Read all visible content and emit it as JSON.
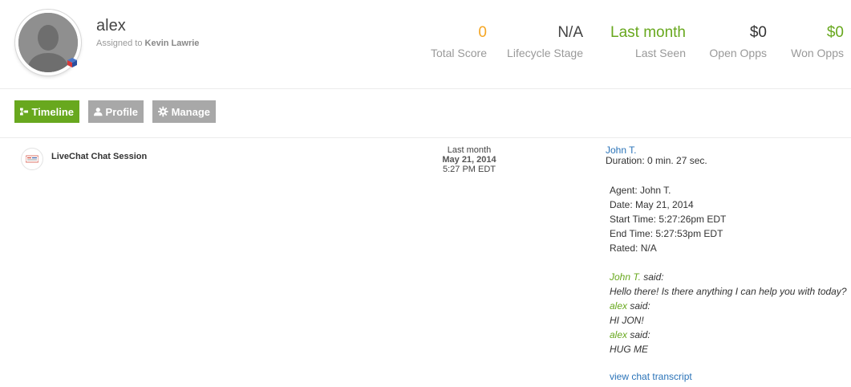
{
  "contact": {
    "name": "alex",
    "assigned_prefix": "Assigned to",
    "assigned_to": "Kevin Lawrie"
  },
  "stats": [
    {
      "value": "0",
      "label": "Total Score",
      "color": "#f5a623"
    },
    {
      "value": "N/A",
      "label": "Lifecycle Stage",
      "color": "#444444"
    },
    {
      "value": "Last month",
      "label": "Last Seen",
      "color": "#68a81e"
    },
    {
      "value": "$0",
      "label": "Open Opps",
      "color": "#333333"
    },
    {
      "value": "$0",
      "label": "Won Opps",
      "color": "#68a81e"
    }
  ],
  "tabs": [
    {
      "label": "Timeline",
      "icon": "timeline-icon",
      "active": true
    },
    {
      "label": "Profile",
      "icon": "person-icon",
      "active": false
    },
    {
      "label": "Manage",
      "icon": "gear-icon",
      "active": false
    }
  ],
  "entry": {
    "icon": "livechat-logo-icon",
    "title": "LiveChat Chat Session",
    "when_relative": "Last month",
    "when_date": "May 21, 2014",
    "when_time": "5:27 PM EDT",
    "agent_link": "John T.",
    "duration": "Duration: 0 min. 27 sec.",
    "meta": [
      "Agent: John T.",
      "Date: May 21, 2014",
      "Start Time: 5:27:26pm EDT",
      "End Time: 5:27:53pm EDT",
      "Rated: N/A"
    ],
    "transcript": [
      {
        "who": "John T.",
        "said": " said:",
        "text": "Hello there! Is there anything I can help you with today?"
      },
      {
        "who": "alex",
        "said": " said:",
        "text": "HI JON!"
      },
      {
        "who": "alex",
        "said": " said:",
        "text": "HUG ME"
      }
    ],
    "view_link": "view chat transcript"
  },
  "colors": {
    "accent_green": "#68a81e",
    "tab_inactive": "#a8a8a8",
    "link_blue": "#2a73b8",
    "score_orange": "#f5a623"
  }
}
